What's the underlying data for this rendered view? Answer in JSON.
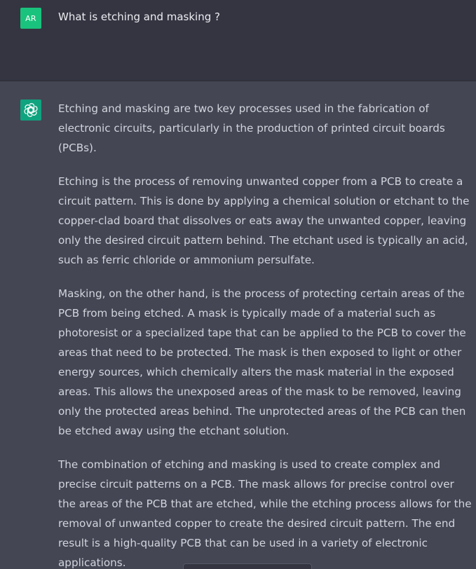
{
  "conversation": {
    "user": {
      "avatar_initials": "AR",
      "message": "What is etching and masking ?"
    },
    "assistant": {
      "avatar_icon": "openai-logo-icon",
      "paragraphs": [
        "Etching and masking are two key processes used in the fabrication of electronic circuits, particularly in the production of printed circuit boards (PCBs).",
        "Etching is the process of removing unwanted copper from a PCB to create a circuit pattern. This is done by applying a chemical solution or etchant to the copper-clad board that dissolves or eats away the unwanted copper, leaving only the desired circuit pattern behind. The etchant used is typically an acid, such as ferric chloride or ammonium persulfate.",
        "Masking, on the other hand, is the process of protecting certain areas of the PCB from being etched. A mask is typically made of a material such as photoresist or a specialized tape that can be applied to the PCB to cover the areas that need to be protected. The mask is then exposed to light or other energy sources, which chemically alters the mask material in the exposed areas. This allows the unexposed areas of the mask to be removed, leaving only the protected areas behind. The unprotected areas of the PCB can then be etched away using the etchant solution.",
        "The combination of etching and masking is used to create complex and precise circuit patterns on a PCB. The mask allows for precise control over the areas of the PCB that are etched, while the etching process allows for the removal of unwanted copper to create the desired circuit pattern. The end result is a high-quality PCB that can be used in a variety of electronic applications."
      ]
    }
  },
  "colors": {
    "user_bg": "#343541",
    "assistant_bg": "#444654",
    "user_avatar": "#19c37d",
    "bot_avatar": "#10a37f",
    "text": "#d1d5db"
  }
}
